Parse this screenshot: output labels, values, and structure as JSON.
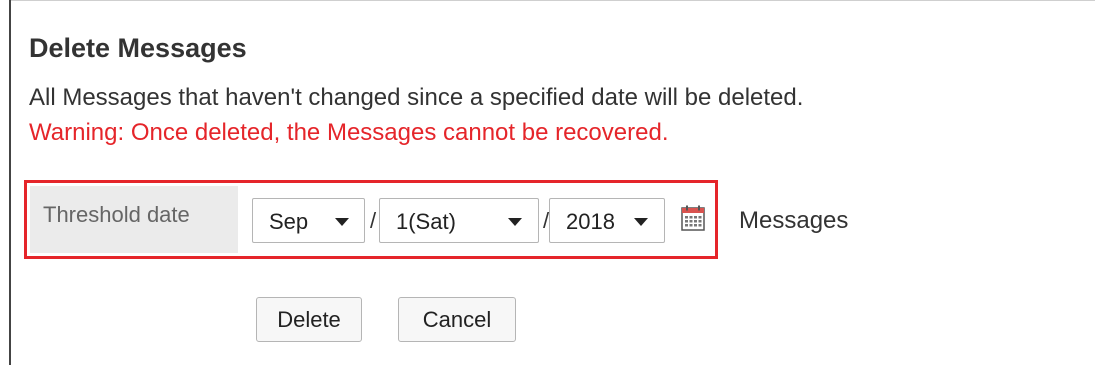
{
  "dialog": {
    "title": "Delete Messages",
    "description": "All Messages that haven't changed since a specified date will be deleted.",
    "warning": "Warning: Once deleted, the Messages cannot be recovered."
  },
  "form": {
    "threshold_label": "Threshold date",
    "month": "Sep",
    "day": "1(Sat)",
    "year": "2018",
    "separator": "/",
    "suffix": "Messages",
    "calendar_icon": "calendar-icon"
  },
  "actions": {
    "delete_label": "Delete",
    "cancel_label": "Cancel"
  },
  "colors": {
    "warning": "#e5252a",
    "highlight_border": "#e5252a",
    "label_background": "#ebebeb"
  }
}
